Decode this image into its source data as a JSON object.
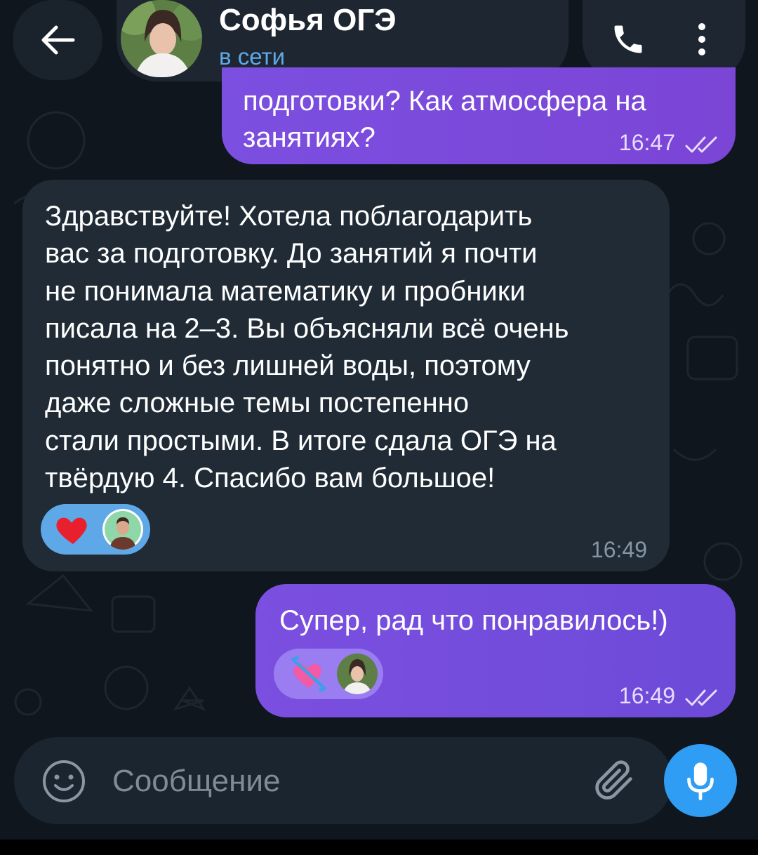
{
  "header": {
    "contact_name": "Софья ОГЭ",
    "status": "в сети",
    "back_icon": "arrow-left-icon",
    "call_icon": "phone-icon",
    "menu_icon": "more-vertical-icon"
  },
  "messages": [
    {
      "direction": "outgoing",
      "text": "подготовки? Как атмосфера на\nзанятиях?",
      "time": "16:47",
      "status_icon": "double-check-icon"
    },
    {
      "direction": "incoming",
      "text": "Здравствуйте! Хотела поблагодарить\nвас за подготовку. До занятий я почти\nне понимала математику и пробники\nписала на 2–3. Вы объясняли всё очень\nпонятно и без лишней воды, поэтому\nдаже сложные темы постепенно\nстали простыми. В итоге сдала ОГЭ на\nтвёрдую 4. Спасибо вам большое!",
      "time": "16:49",
      "reaction": {
        "emoji": "❤️",
        "icon": "red-heart-icon"
      }
    },
    {
      "direction": "outgoing",
      "text": "Супер, рад что понравилось!)",
      "time": "16:49",
      "status_icon": "double-check-icon",
      "reaction": {
        "emoji": "💘",
        "icon": "heart-with-arrow-icon"
      }
    }
  ],
  "composer": {
    "placeholder": "Сообщение",
    "emoji_icon": "emoji-icon",
    "attach_icon": "paperclip-icon",
    "mic_icon": "microphone-icon"
  },
  "colors": {
    "background": "#0f161e",
    "outgoing_bubble": "#7b4fe0",
    "incoming_bubble": "#202b36",
    "accent_blue": "#2f9df4",
    "status_online": "#5fa8e8"
  }
}
